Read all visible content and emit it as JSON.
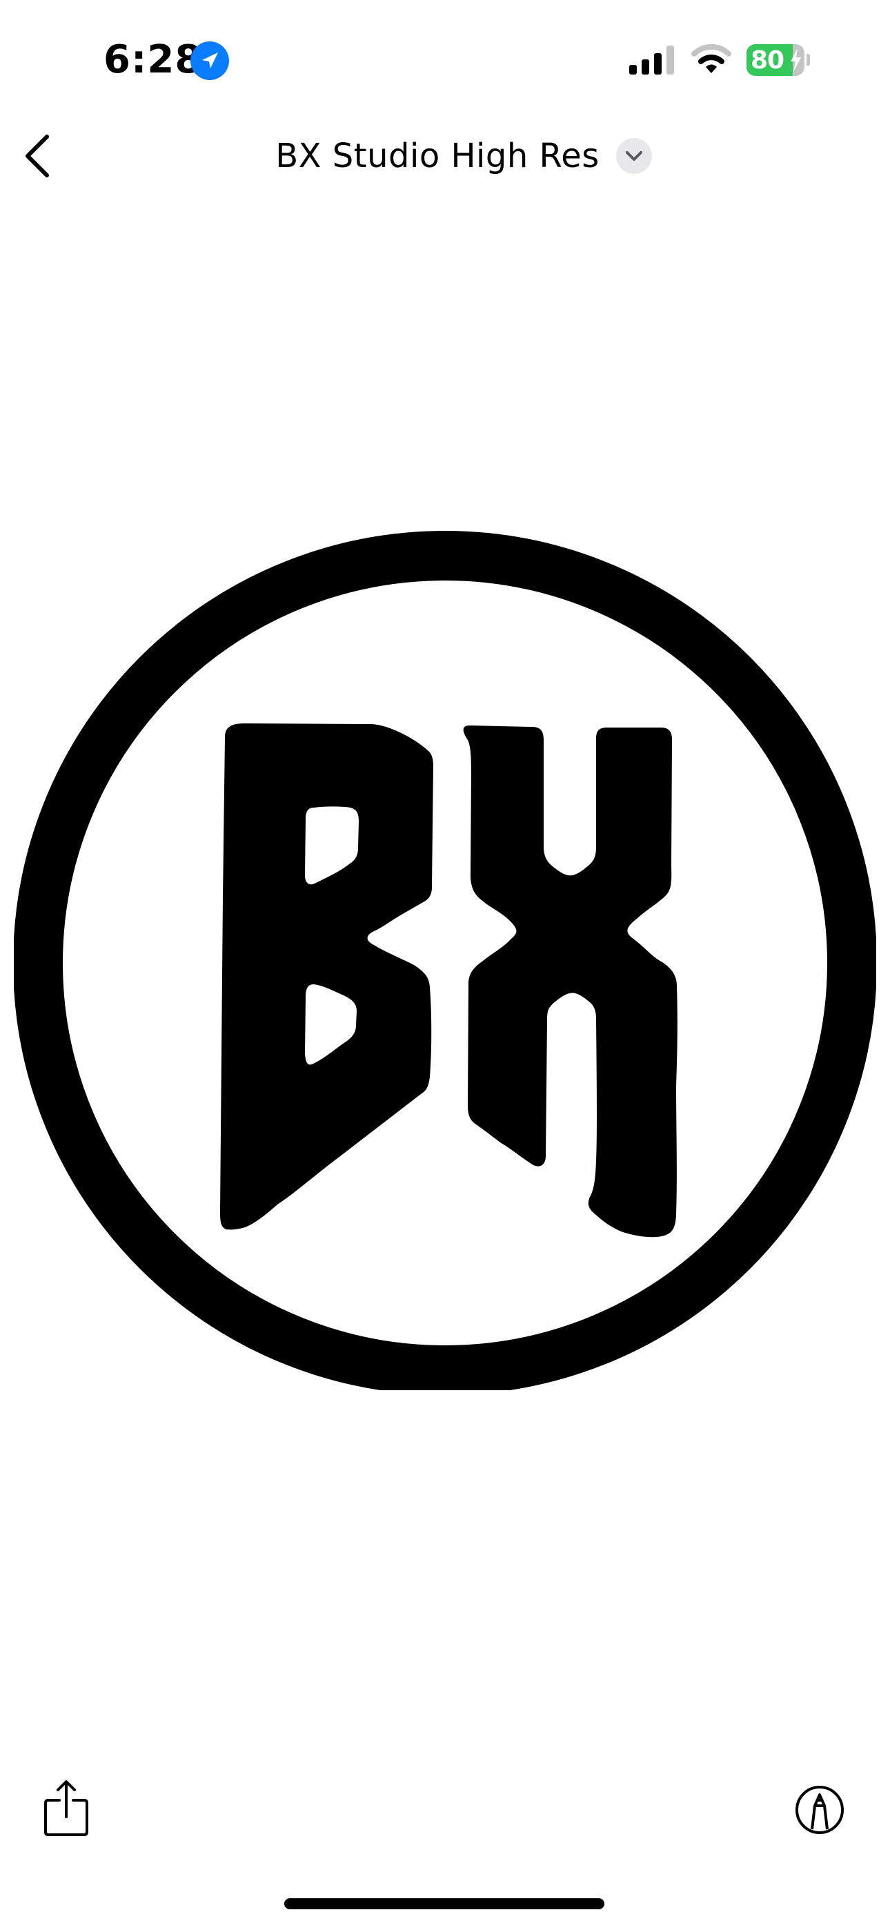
{
  "status_bar": {
    "time": "6:28",
    "battery_level": "80",
    "battery_fraction": 0.8,
    "icons": [
      "location-icon",
      "cellular-signal-icon",
      "wifi-icon",
      "battery-icon",
      "charging-bolt-icon"
    ]
  },
  "nav": {
    "title": "BX Studio High Res",
    "back_icon": "chevron-left-icon",
    "dropdown_icon": "chevron-down-icon"
  },
  "content": {
    "logo_text": "BX",
    "logo_description_icon": "bx-logo"
  },
  "toolbar": {
    "share_icon": "share-icon",
    "markup_icon": "markup-icon"
  },
  "colors": {
    "accent": "#0a7cff",
    "battery_green": "#34c759",
    "logo": "#000000",
    "badge_gray": "#e8e8ea"
  }
}
